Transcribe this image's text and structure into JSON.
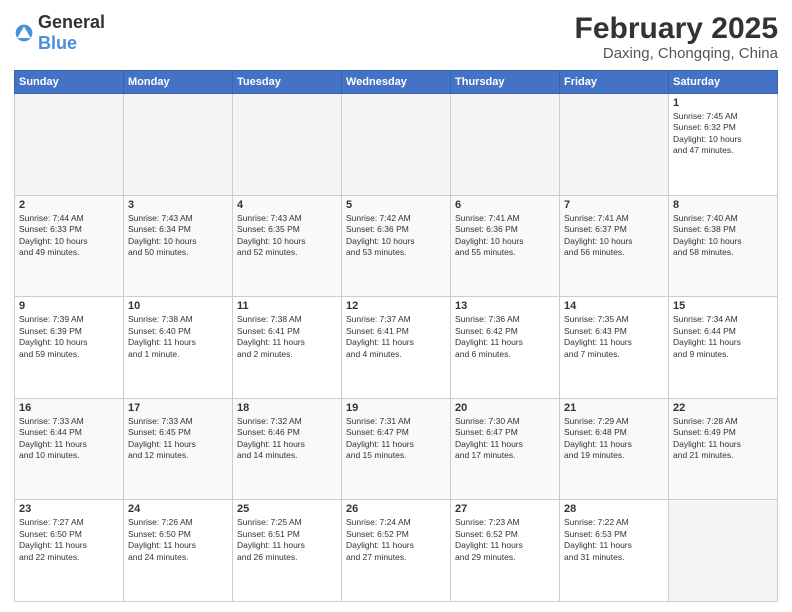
{
  "logo": {
    "general": "General",
    "blue": "Blue"
  },
  "header": {
    "month_year": "February 2025",
    "location": "Daxing, Chongqing, China"
  },
  "days_of_week": [
    "Sunday",
    "Monday",
    "Tuesday",
    "Wednesday",
    "Thursday",
    "Friday",
    "Saturday"
  ],
  "weeks": [
    [
      {
        "day": "",
        "info": ""
      },
      {
        "day": "",
        "info": ""
      },
      {
        "day": "",
        "info": ""
      },
      {
        "day": "",
        "info": ""
      },
      {
        "day": "",
        "info": ""
      },
      {
        "day": "",
        "info": ""
      },
      {
        "day": "1",
        "info": "Sunrise: 7:45 AM\nSunset: 6:32 PM\nDaylight: 10 hours\nand 47 minutes."
      }
    ],
    [
      {
        "day": "2",
        "info": "Sunrise: 7:44 AM\nSunset: 6:33 PM\nDaylight: 10 hours\nand 49 minutes."
      },
      {
        "day": "3",
        "info": "Sunrise: 7:43 AM\nSunset: 6:34 PM\nDaylight: 10 hours\nand 50 minutes."
      },
      {
        "day": "4",
        "info": "Sunrise: 7:43 AM\nSunset: 6:35 PM\nDaylight: 10 hours\nand 52 minutes."
      },
      {
        "day": "5",
        "info": "Sunrise: 7:42 AM\nSunset: 6:36 PM\nDaylight: 10 hours\nand 53 minutes."
      },
      {
        "day": "6",
        "info": "Sunrise: 7:41 AM\nSunset: 6:36 PM\nDaylight: 10 hours\nand 55 minutes."
      },
      {
        "day": "7",
        "info": "Sunrise: 7:41 AM\nSunset: 6:37 PM\nDaylight: 10 hours\nand 56 minutes."
      },
      {
        "day": "8",
        "info": "Sunrise: 7:40 AM\nSunset: 6:38 PM\nDaylight: 10 hours\nand 58 minutes."
      }
    ],
    [
      {
        "day": "9",
        "info": "Sunrise: 7:39 AM\nSunset: 6:39 PM\nDaylight: 10 hours\nand 59 minutes."
      },
      {
        "day": "10",
        "info": "Sunrise: 7:38 AM\nSunset: 6:40 PM\nDaylight: 11 hours\nand 1 minute."
      },
      {
        "day": "11",
        "info": "Sunrise: 7:38 AM\nSunset: 6:41 PM\nDaylight: 11 hours\nand 2 minutes."
      },
      {
        "day": "12",
        "info": "Sunrise: 7:37 AM\nSunset: 6:41 PM\nDaylight: 11 hours\nand 4 minutes."
      },
      {
        "day": "13",
        "info": "Sunrise: 7:36 AM\nSunset: 6:42 PM\nDaylight: 11 hours\nand 6 minutes."
      },
      {
        "day": "14",
        "info": "Sunrise: 7:35 AM\nSunset: 6:43 PM\nDaylight: 11 hours\nand 7 minutes."
      },
      {
        "day": "15",
        "info": "Sunrise: 7:34 AM\nSunset: 6:44 PM\nDaylight: 11 hours\nand 9 minutes."
      }
    ],
    [
      {
        "day": "16",
        "info": "Sunrise: 7:33 AM\nSunset: 6:44 PM\nDaylight: 11 hours\nand 10 minutes."
      },
      {
        "day": "17",
        "info": "Sunrise: 7:33 AM\nSunset: 6:45 PM\nDaylight: 11 hours\nand 12 minutes."
      },
      {
        "day": "18",
        "info": "Sunrise: 7:32 AM\nSunset: 6:46 PM\nDaylight: 11 hours\nand 14 minutes."
      },
      {
        "day": "19",
        "info": "Sunrise: 7:31 AM\nSunset: 6:47 PM\nDaylight: 11 hours\nand 15 minutes."
      },
      {
        "day": "20",
        "info": "Sunrise: 7:30 AM\nSunset: 6:47 PM\nDaylight: 11 hours\nand 17 minutes."
      },
      {
        "day": "21",
        "info": "Sunrise: 7:29 AM\nSunset: 6:48 PM\nDaylight: 11 hours\nand 19 minutes."
      },
      {
        "day": "22",
        "info": "Sunrise: 7:28 AM\nSunset: 6:49 PM\nDaylight: 11 hours\nand 21 minutes."
      }
    ],
    [
      {
        "day": "23",
        "info": "Sunrise: 7:27 AM\nSunset: 6:50 PM\nDaylight: 11 hours\nand 22 minutes."
      },
      {
        "day": "24",
        "info": "Sunrise: 7:26 AM\nSunset: 6:50 PM\nDaylight: 11 hours\nand 24 minutes."
      },
      {
        "day": "25",
        "info": "Sunrise: 7:25 AM\nSunset: 6:51 PM\nDaylight: 11 hours\nand 26 minutes."
      },
      {
        "day": "26",
        "info": "Sunrise: 7:24 AM\nSunset: 6:52 PM\nDaylight: 11 hours\nand 27 minutes."
      },
      {
        "day": "27",
        "info": "Sunrise: 7:23 AM\nSunset: 6:52 PM\nDaylight: 11 hours\nand 29 minutes."
      },
      {
        "day": "28",
        "info": "Sunrise: 7:22 AM\nSunset: 6:53 PM\nDaylight: 11 hours\nand 31 minutes."
      },
      {
        "day": "",
        "info": ""
      }
    ]
  ]
}
